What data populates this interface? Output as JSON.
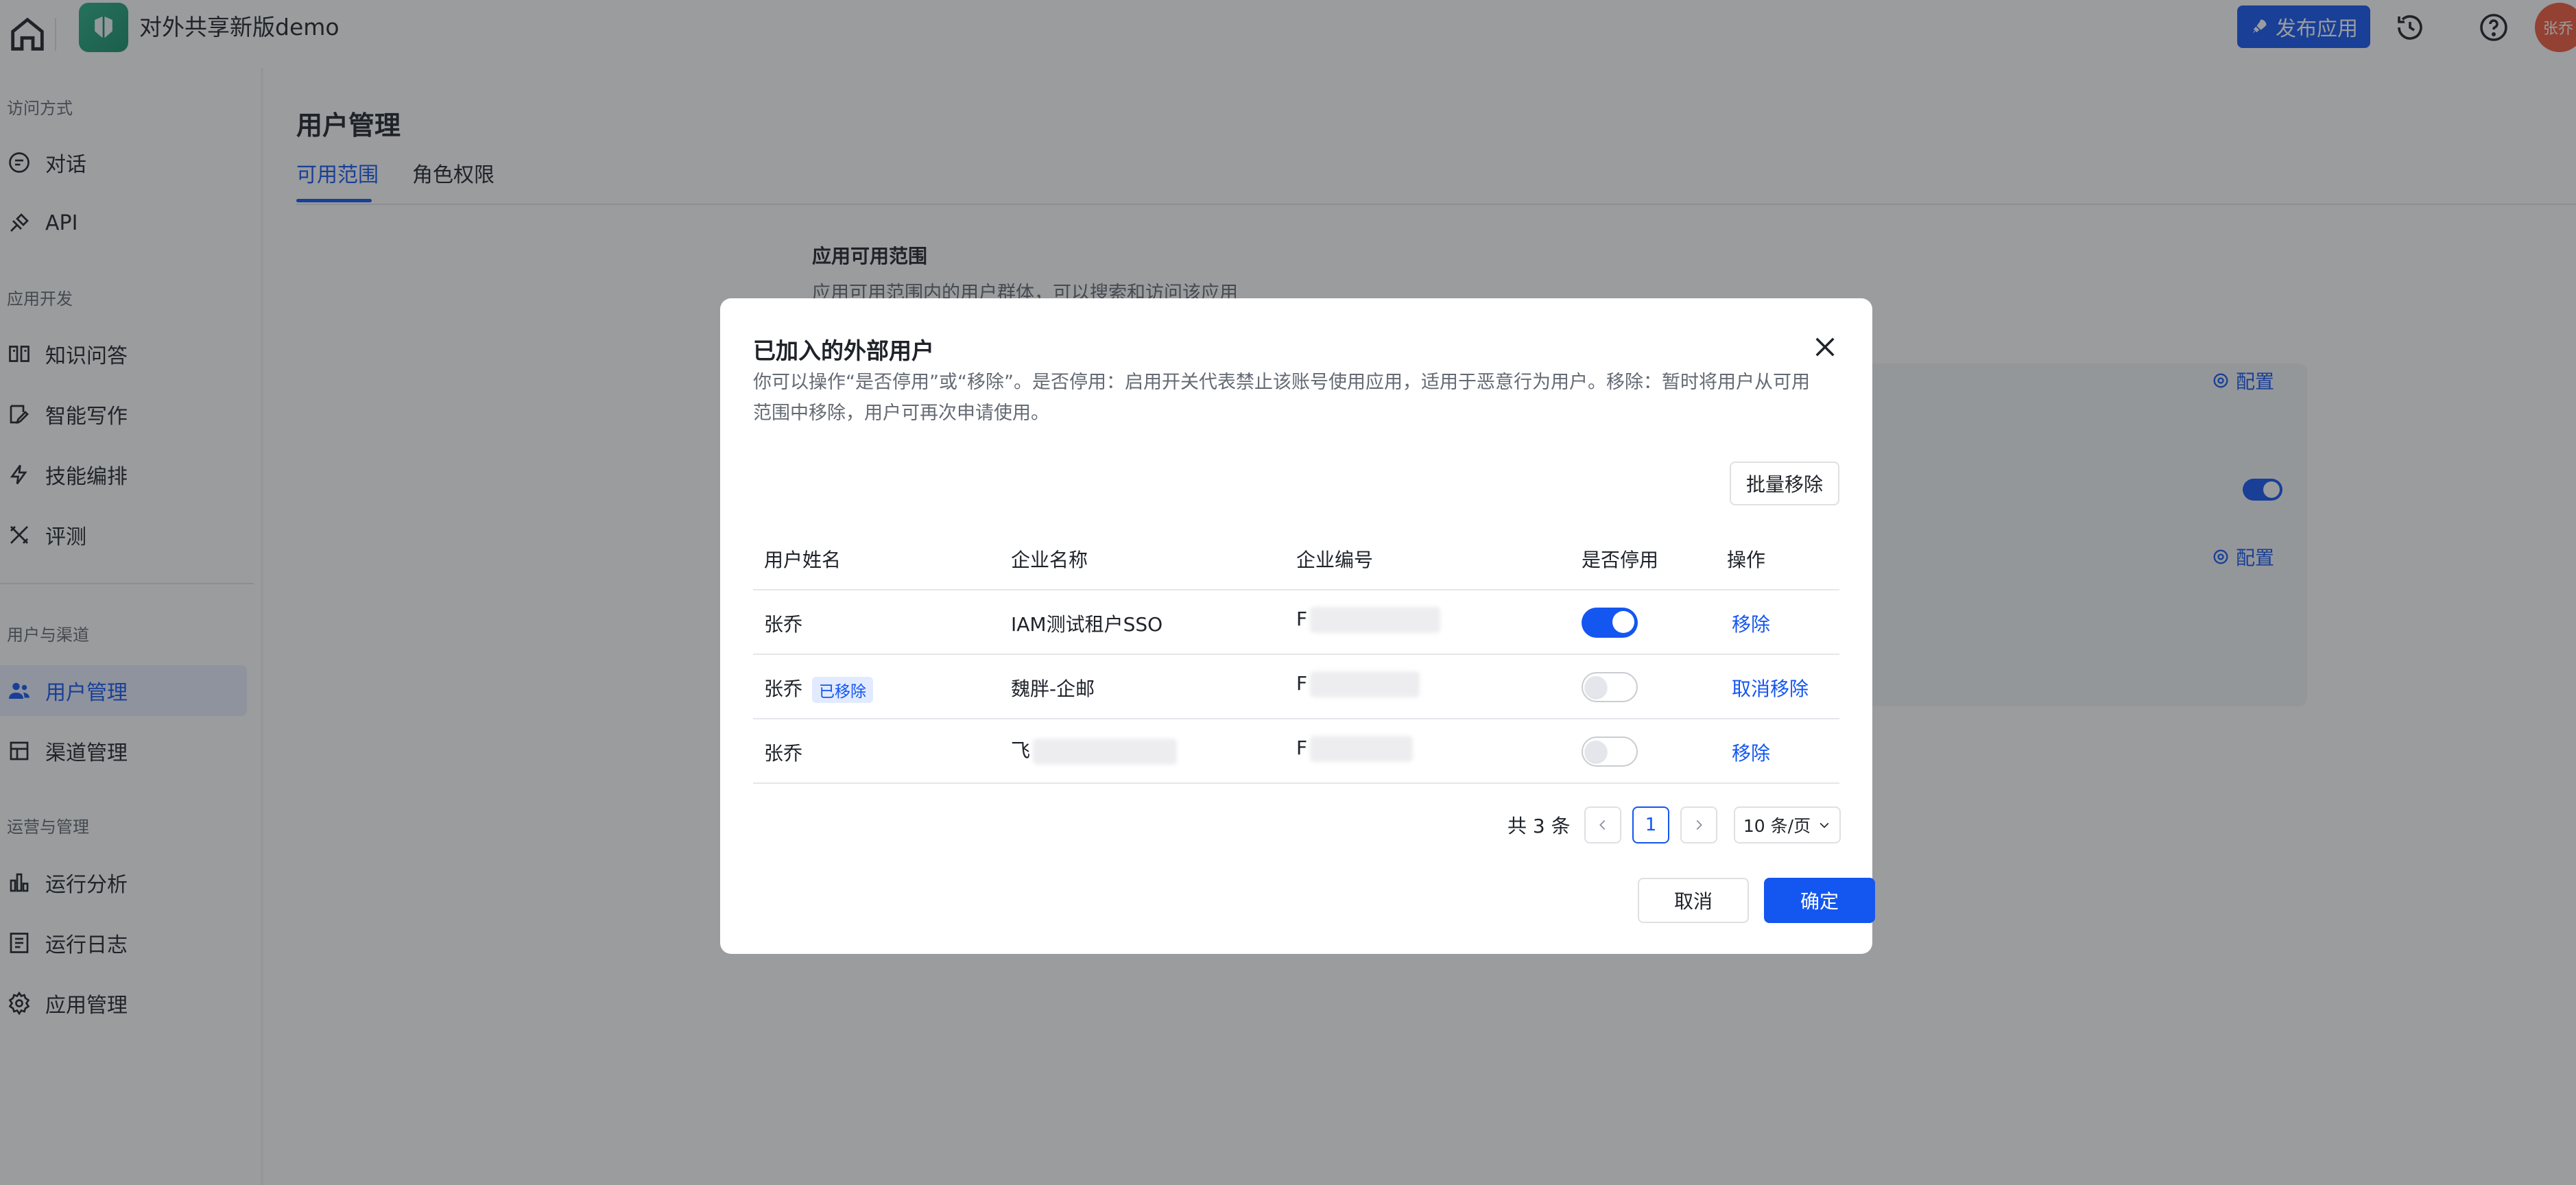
{
  "header": {
    "app_title": "对外共享新版demo",
    "publish_label": "发布应用",
    "avatar_text": "张乔"
  },
  "sidebar": {
    "sections": [
      {
        "title": "访问方式",
        "items": [
          {
            "label": "对话",
            "icon": "chat-icon"
          },
          {
            "label": "API",
            "icon": "api-icon"
          }
        ]
      },
      {
        "title": "应用开发",
        "items": [
          {
            "label": "知识问答",
            "icon": "book-icon"
          },
          {
            "label": "智能写作",
            "icon": "write-icon"
          },
          {
            "label": "技能编排",
            "icon": "lightning-icon"
          },
          {
            "label": "评测",
            "icon": "tools-icon"
          }
        ]
      },
      {
        "title": "用户与渠道",
        "items": [
          {
            "label": "用户管理",
            "icon": "users-icon"
          },
          {
            "label": "渠道管理",
            "icon": "channel-icon"
          }
        ]
      },
      {
        "title": "运营与管理",
        "items": [
          {
            "label": "运行分析",
            "icon": "bar-chart-icon"
          },
          {
            "label": "运行日志",
            "icon": "log-icon"
          },
          {
            "label": "应用管理",
            "icon": "gear-icon"
          }
        ]
      }
    ],
    "active_item": "用户管理"
  },
  "main": {
    "title": "用户管理",
    "tabs": [
      {
        "label": "可用范围"
      },
      {
        "label": "角色权限"
      }
    ],
    "active_tab": "可用范围",
    "section_title": "应用可用范围",
    "section_desc": "应用可用范围内的用户群体，可以搜索和访问该应用",
    "config_label": "配置"
  },
  "modal": {
    "title": "已加入的外部用户",
    "description": "你可以操作“是否停用”或“移除”。是否停用：启用开关代表禁止该账号使用应用，适用于恶意行为用户。移除：暂时将用户从可用范围中移除，用户可再次申请使用。",
    "batch_remove": "批量移除",
    "columns": [
      "用户姓名",
      "企业名称",
      "企业编号",
      "是否停用",
      "操作"
    ],
    "rows": [
      {
        "name": "张乔",
        "tag": "",
        "company": "IAM测试租户SSO",
        "company_id": "F",
        "disabled": true,
        "action": "移除"
      },
      {
        "name": "张乔",
        "tag": "已移除",
        "company": "魏胖-企邮",
        "company_id": "F",
        "disabled": false,
        "action": "取消移除"
      },
      {
        "name": "张乔",
        "tag": "",
        "company": "飞",
        "company_id": "F",
        "disabled": false,
        "action": "移除"
      }
    ],
    "pagination": {
      "total_text": "共 3 条",
      "current_page": "1",
      "page_size": "10 条/页"
    },
    "cancel_label": "取消",
    "confirm_label": "确定"
  },
  "colors": {
    "accent": "#1456f0",
    "logo": "#2bb187",
    "avatar": "#f25a3c"
  }
}
